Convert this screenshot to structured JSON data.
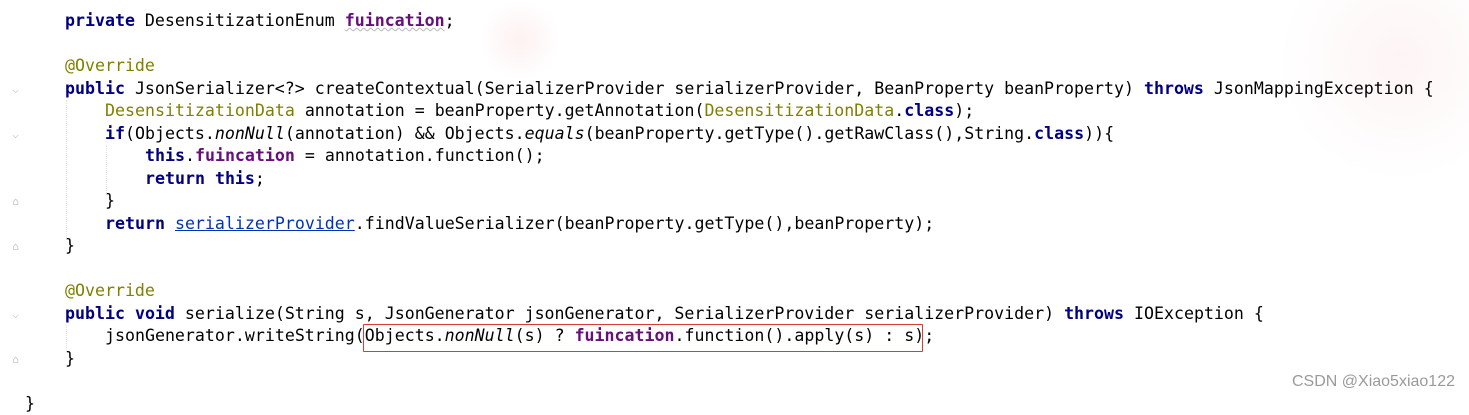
{
  "code": {
    "lines": [
      {
        "indent": 1,
        "tokens": [
          {
            "t": "private",
            "s": "kw"
          },
          {
            "t": " DesensitizationEnum ",
            "s": ""
          },
          {
            "t": "fuincation",
            "s": "fld squig"
          },
          {
            "t": ";",
            "s": ""
          }
        ]
      },
      {
        "indent": 0,
        "tokens": []
      },
      {
        "indent": 1,
        "tokens": [
          {
            "t": "@Override",
            "s": "ann"
          }
        ]
      },
      {
        "indent": 1,
        "tokens": [
          {
            "t": "public",
            "s": "kw"
          },
          {
            "t": " JsonSerializer<?> createContextual(SerializerProvider serializerProvider, BeanProperty beanProperty) ",
            "s": ""
          },
          {
            "t": "throws",
            "s": "kw"
          },
          {
            "t": " JsonMappingException {",
            "s": ""
          }
        ]
      },
      {
        "indent": 2,
        "tokens": [
          {
            "t": "DesensitizationData",
            "s": "typ"
          },
          {
            "t": " annotation = beanProperty.getAnnotation(",
            "s": ""
          },
          {
            "t": "DesensitizationData",
            "s": "typ"
          },
          {
            "t": ".",
            "s": ""
          },
          {
            "t": "class",
            "s": "kw"
          },
          {
            "t": ");",
            "s": ""
          }
        ]
      },
      {
        "indent": 2,
        "tokens": [
          {
            "t": "if",
            "s": "kw"
          },
          {
            "t": "(Objects.",
            "s": ""
          },
          {
            "t": "nonNull",
            "s": "it"
          },
          {
            "t": "(annotation) && Objects.",
            "s": ""
          },
          {
            "t": "equals",
            "s": "it"
          },
          {
            "t": "(beanProperty.getType().getRawClass(),String.",
            "s": ""
          },
          {
            "t": "class",
            "s": "kw"
          },
          {
            "t": ")){",
            "s": ""
          }
        ]
      },
      {
        "indent": 3,
        "tokens": [
          {
            "t": "this",
            "s": "kw"
          },
          {
            "t": ".",
            "s": ""
          },
          {
            "t": "fuincation",
            "s": "fld"
          },
          {
            "t": " = annotation.function();",
            "s": ""
          }
        ]
      },
      {
        "indent": 3,
        "tokens": [
          {
            "t": "return",
            "s": "kw"
          },
          {
            "t": " ",
            "s": ""
          },
          {
            "t": "this",
            "s": "kw"
          },
          {
            "t": ";",
            "s": ""
          }
        ]
      },
      {
        "indent": 2,
        "tokens": [
          {
            "t": "}",
            "s": ""
          }
        ]
      },
      {
        "indent": 2,
        "tokens": [
          {
            "t": "return",
            "s": "kw"
          },
          {
            "t": " ",
            "s": ""
          },
          {
            "t": "serializerProvider",
            "s": "link"
          },
          {
            "t": ".findValueSerializer(beanProperty.getType(),beanProperty);",
            "s": ""
          }
        ]
      },
      {
        "indent": 1,
        "tokens": [
          {
            "t": "}",
            "s": ""
          }
        ]
      },
      {
        "indent": 0,
        "tokens": []
      },
      {
        "indent": 1,
        "tokens": [
          {
            "t": "@Override",
            "s": "ann"
          }
        ]
      },
      {
        "indent": 1,
        "tokens": [
          {
            "t": "public",
            "s": "kw"
          },
          {
            "t": " ",
            "s": ""
          },
          {
            "t": "void",
            "s": "kw"
          },
          {
            "t": " serialize(String s, JsonGenerator jsonGenerator, SerializerProvider serializerProvider) ",
            "s": ""
          },
          {
            "t": "throws",
            "s": "kw"
          },
          {
            "t": " IOException {",
            "s": ""
          }
        ]
      },
      {
        "indent": 2,
        "tokens": [
          {
            "t": "jsonGenerator.writeString(Objects.",
            "s": ""
          },
          {
            "t": "nonNull",
            "s": "it"
          },
          {
            "t": "(s) ? ",
            "s": ""
          },
          {
            "t": "fuincation",
            "s": "fld"
          },
          {
            "t": ".function().apply(s) : s);",
            "s": ""
          }
        ]
      },
      {
        "indent": 1,
        "tokens": [
          {
            "t": "}",
            "s": ""
          }
        ]
      },
      {
        "indent": 0,
        "tokens": []
      },
      {
        "indent": 0,
        "tokens": [
          {
            "t": "}",
            "s": ""
          }
        ]
      }
    ]
  },
  "watermark": "CSDN @Xiao5xiao122"
}
